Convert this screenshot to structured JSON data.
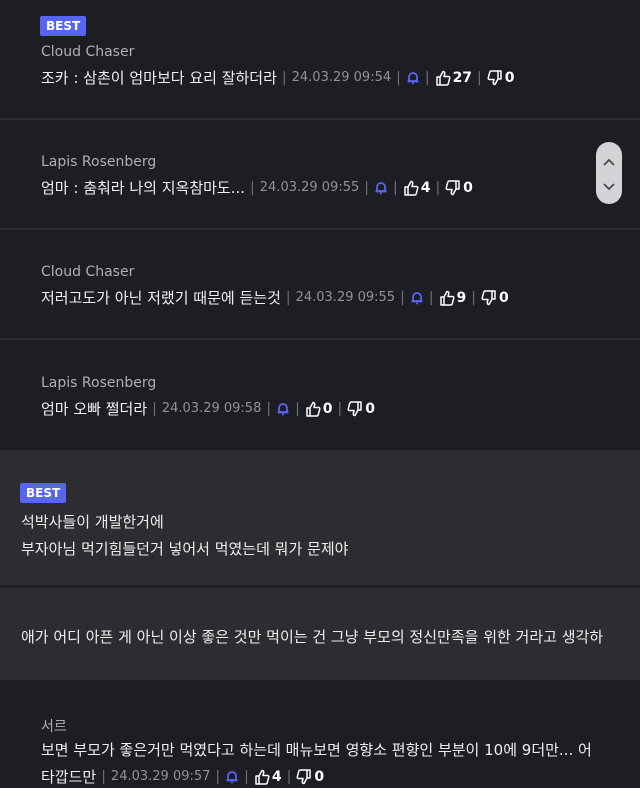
{
  "comments": [
    {
      "badge": "BEST",
      "author": "Cloud Chaser",
      "text": "조카 : 삼촌이 엄마보다 요리 잘하더라",
      "date": "24.03.29 09:54",
      "up": "27",
      "down": "0"
    },
    {
      "author": "Lapis Rosenberg",
      "text": "엄마 : 춤춰라 나의 지옥참마도...",
      "date": "24.03.29 09:55",
      "up": "4",
      "down": "0"
    },
    {
      "author": "Cloud Chaser",
      "text": "저러고도가 아닌 저랬기 때문에 듣는것",
      "date": "24.03.29 09:55",
      "up": "9",
      "down": "0"
    },
    {
      "author": "Lapis Rosenberg",
      "text": "엄마 오빠 쩔더라",
      "date": "24.03.29 09:58",
      "up": "0",
      "down": "0"
    }
  ],
  "best_post": {
    "badge": "BEST",
    "line1": "석박사들이 개발한거에",
    "line2": "부자아님 먹기힘들던거 넣어서 먹였는데 뭐가 문제야"
  },
  "reply_post": {
    "text": "애가 어디 아픈 게 아닌 이상 좋은 것만 먹이는 건 그냥 부모의 정신만족을 위한 거라고 생각하"
  },
  "last_comment": {
    "author": "서르",
    "line1": "보면 부모가 좋은거만 먹였다고 하는데 매뉴보면 영향소 편향인 부분이 10에 9더만... 어",
    "line2": "타깝드만",
    "date": "24.03.29 09:57",
    "up": "4",
    "down": "0"
  },
  "colors": {
    "accent": "#5865f2",
    "background": "#1c1e23",
    "panel": "#2b2d31"
  },
  "icons": [
    "bell-icon",
    "thumbs-up-icon",
    "thumbs-down-icon",
    "chevron-up-icon",
    "chevron-down-icon"
  ]
}
